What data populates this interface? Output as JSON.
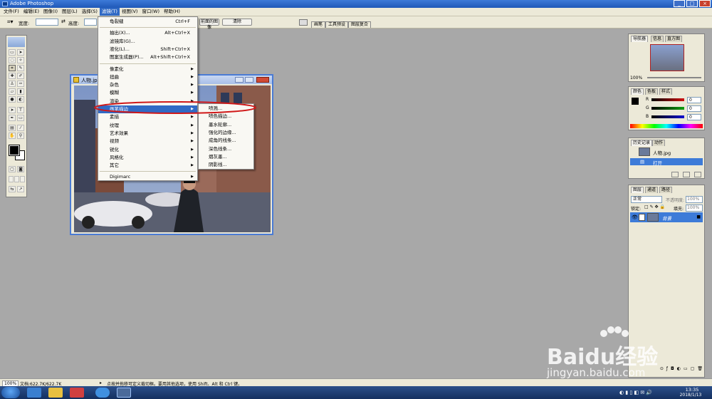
{
  "app": {
    "title": "Adobe Photoshop"
  },
  "menubar": {
    "items": [
      "文件(F)",
      "编辑(E)",
      "图像(I)",
      "图层(L)",
      "选择(S)",
      "滤镜(T)",
      "视图(V)",
      "窗口(W)",
      "帮助(H)"
    ],
    "active_index": 5
  },
  "options_bar": {
    "width_label": "宽度:",
    "height_label": "高度:",
    "front_image_button": "前面的图像",
    "clear_button": "清除",
    "palette_tabs": [
      "画笔",
      "工具预设",
      "图层复合"
    ]
  },
  "document": {
    "title": "人物.jpg"
  },
  "filter_menu": {
    "items": [
      {
        "label": "龟裂缝",
        "shortcut": "Ctrl+F",
        "submenu": false
      },
      {
        "sep": true
      },
      {
        "label": "抽出(X)...",
        "shortcut": "Alt+Ctrl+X",
        "submenu": false
      },
      {
        "label": "滤镜库(G)...",
        "shortcut": "",
        "submenu": false
      },
      {
        "label": "液化(L)...",
        "shortcut": "Shift+Ctrl+X",
        "submenu": false
      },
      {
        "label": "图案生成器(P)...",
        "shortcut": "Alt+Shift+Ctrl+X",
        "submenu": false
      },
      {
        "sep": true
      },
      {
        "label": "像素化",
        "shortcut": "",
        "submenu": true
      },
      {
        "label": "扭曲",
        "shortcut": "",
        "submenu": true
      },
      {
        "label": "杂色",
        "shortcut": "",
        "submenu": true
      },
      {
        "label": "模糊",
        "shortcut": "",
        "submenu": true
      },
      {
        "label": "渲染",
        "shortcut": "",
        "submenu": true
      },
      {
        "label": "画笔描边",
        "shortcut": "",
        "submenu": true,
        "highlighted": true
      },
      {
        "label": "素描",
        "shortcut": "",
        "submenu": true
      },
      {
        "label": "纹理",
        "shortcut": "",
        "submenu": true
      },
      {
        "label": "艺术效果",
        "shortcut": "",
        "submenu": true
      },
      {
        "label": "视频",
        "shortcut": "",
        "submenu": true
      },
      {
        "label": "锐化",
        "shortcut": "",
        "submenu": true
      },
      {
        "label": "风格化",
        "shortcut": "",
        "submenu": true
      },
      {
        "label": "其它",
        "shortcut": "",
        "submenu": true
      },
      {
        "sep": true
      },
      {
        "label": "Digimarc",
        "shortcut": "",
        "submenu": true
      }
    ]
  },
  "brush_stroke_submenu": {
    "items": [
      "喷溅...",
      "喷色描边...",
      "墨水轮廓...",
      "强化的边缘...",
      "成角的线条...",
      "深色线条...",
      "烟灰墨...",
      "阴影线..."
    ]
  },
  "navigator_panel": {
    "tabs": [
      "导航器",
      "信息",
      "直方图"
    ],
    "zoom": "100%"
  },
  "color_panel": {
    "tabs": [
      "颜色",
      "色板",
      "样式"
    ],
    "channels": [
      {
        "label": "R",
        "value": "0",
        "color": "#d01010"
      },
      {
        "label": "G",
        "value": "0",
        "color": "#10a010"
      },
      {
        "label": "B",
        "value": "0",
        "color": "#1010d0"
      }
    ]
  },
  "history_panel": {
    "tabs": [
      "历史记录",
      "动作"
    ],
    "snapshot": "人物.jpg",
    "steps": [
      "打开"
    ]
  },
  "layers_panel": {
    "tabs": [
      "图层",
      "通道",
      "路径"
    ],
    "blend_mode": "正常",
    "opacity_label": "不透明度:",
    "opacity_value": "100%",
    "lock_label": "锁定:",
    "fill_label": "填充:",
    "fill_value": "100%",
    "layers": [
      "背景"
    ]
  },
  "status": {
    "zoom": "100%",
    "doc_size": "文档:622.7K/622.7K",
    "hint": "点按并拖移可定义裁切框。要用其他选项，使用 Shift、Alt 和 Ctrl 键。"
  },
  "taskbar": {
    "time": "13:35",
    "date": "2018/1/13"
  },
  "watermark": {
    "brand": "Baidu经验",
    "url": "jingyan.baidu.com"
  },
  "colors": {
    "accent": "#316ac5",
    "highlight_oval": "#d01818"
  }
}
